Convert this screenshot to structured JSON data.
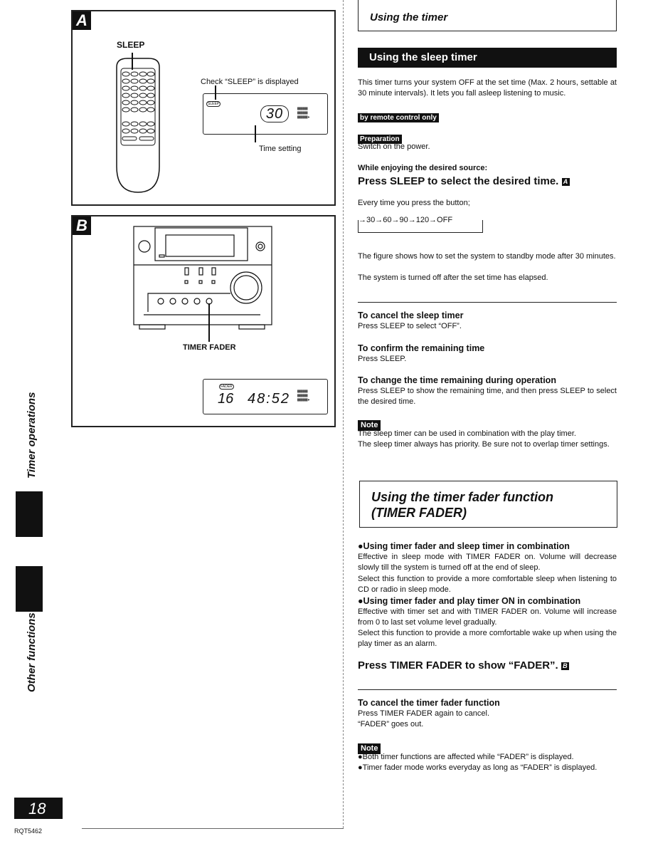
{
  "figure_a": {
    "label": "A",
    "sleep_label": "SLEEP",
    "check_text": "Check “SLEEP” is displayed",
    "display_indicator": "SLEEP",
    "display_value": "30",
    "time_setting_label": "Time setting"
  },
  "figure_b": {
    "label": "B",
    "button_label": "TIMER FADER",
    "display_indicator": "FADER",
    "display_left": "16",
    "display_time": "48:52"
  },
  "header": {
    "title": "Using the timer"
  },
  "sleep": {
    "title": "Using the sleep timer",
    "intro": "This timer turns your system OFF at the set time (Max. 2 hours, settable at 30 minute intervals). It lets you fall asleep listening to music.",
    "remote_tag": "by remote control only",
    "prep_tag": "Preparation",
    "prep_text": "Switch on the power.",
    "while": "While enjoying the desired source:",
    "step": "Press SLEEP to select the desired time.",
    "step_ref": "A",
    "every": "Every time you press the button;",
    "cycle": "→30→60→90→120→OFF",
    "fig_note1": "The figure shows how to set the system to standby mode after 30 minutes.",
    "fig_note2": "The system is turned off after the set time has elapsed.",
    "cancel_h": "To cancel the sleep timer",
    "cancel_t": "Press SLEEP to select “OFF”.",
    "confirm_h": "To confirm the remaining time",
    "confirm_t": "Press SLEEP.",
    "change_h": "To change the time remaining during operation",
    "change_t": "Press SLEEP to show the remaining time, and then press SLEEP to select the desired time.",
    "note_tag": "Note",
    "note1": "The sleep timer can be used in combination with the play timer.",
    "note2": "The sleep timer always has priority. Be sure not to overlap timer settings."
  },
  "fader": {
    "title1": "Using the timer fader function",
    "title2": "(TIMER FADER)",
    "b1_h": "●Using timer fader and sleep timer in combination",
    "b1_t1": "Effective in sleep mode with TIMER FADER on. Volume will decrease slowly till the system is turned off at the end of sleep.",
    "b1_t2": "Select this function to provide a more comfortable sleep when listening to CD or radio in sleep mode.",
    "b2_h": "●Using timer fader and play timer ON in combination",
    "b2_t1": "Effective with timer set and with TIMER FADER on. Volume will increase from 0 to last set volume level gradually.",
    "b2_t2": "Select this function to provide a more comfortable wake up when using the play timer as an alarm.",
    "step": "Press TIMER FADER to show “FADER”.",
    "step_ref": "B",
    "cancel_h": "To cancel the timer fader function",
    "cancel_t1": "Press TIMER FADER again to cancel.",
    "cancel_t2": "“FADER” goes out.",
    "note_tag": "Note",
    "note1": "●Both timer functions are affected while “FADER” is displayed.",
    "note2": "●Timer fader mode works everyday as long as “FADER” is displayed."
  },
  "sidebar": {
    "section1": "Timer operations",
    "section2": "Other functions"
  },
  "footer": {
    "page_number": "18",
    "code": "RQT5462"
  }
}
